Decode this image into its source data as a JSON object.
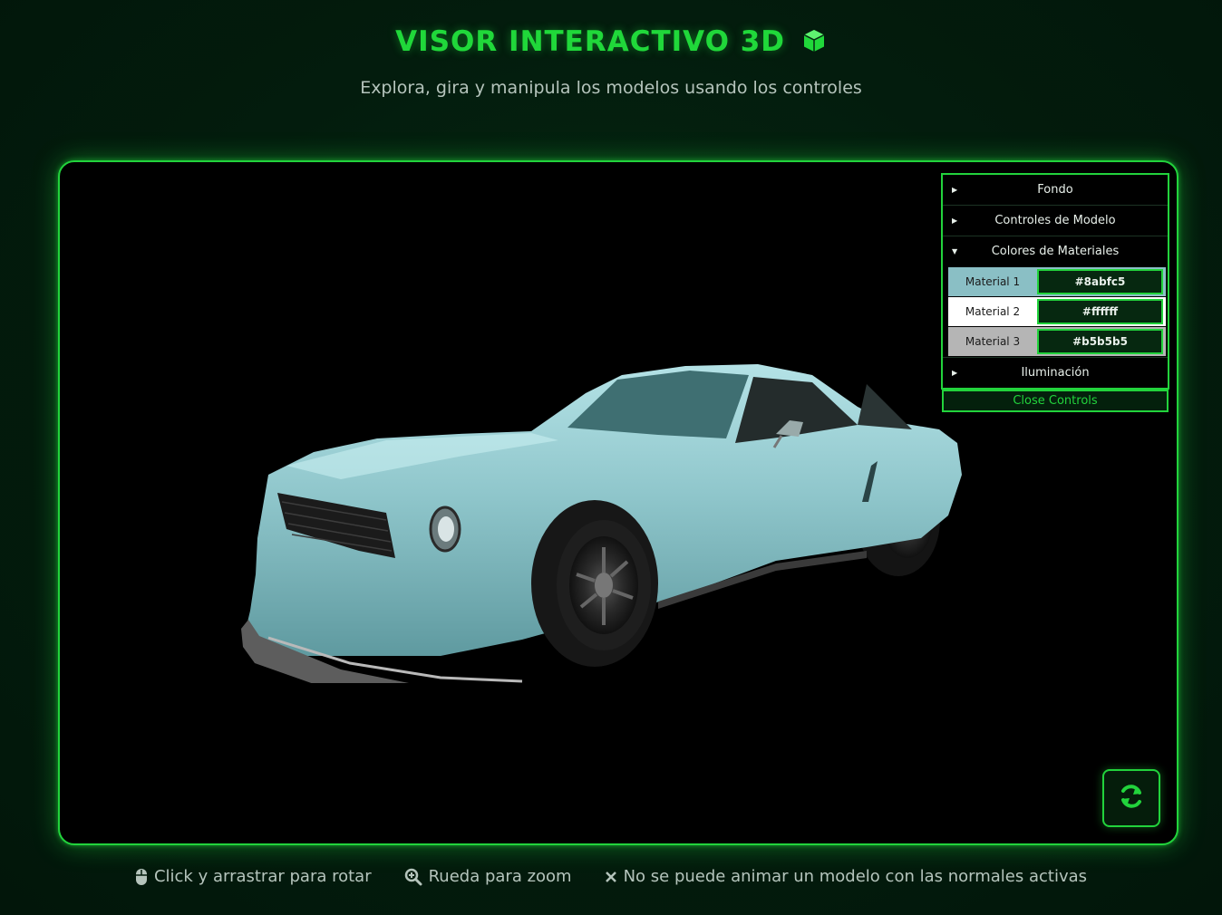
{
  "header": {
    "title": "VISOR INTERACTIVO 3D",
    "title_icon": "cube-icon",
    "subtitle": "Explora, gira y manipula los modelos usando los controles"
  },
  "controls": {
    "folders": [
      {
        "label": "Fondo",
        "expanded": false
      },
      {
        "label": "Controles de Modelo",
        "expanded": false
      },
      {
        "label": "Colores de Materiales",
        "expanded": true
      },
      {
        "label": "Iluminación",
        "expanded": false
      }
    ],
    "materials": [
      {
        "label": "Material 1",
        "value": "#8abfc5"
      },
      {
        "label": "Material 2",
        "value": "#ffffff"
      },
      {
        "label": "Material 3",
        "value": "#b5b5b5"
      }
    ],
    "close_label": "Close Controls"
  },
  "refresh_icon": "refresh-icon",
  "footer": {
    "rotate": {
      "icon": "mouse-icon",
      "text": "Click y arrastrar para rotar"
    },
    "zoom": {
      "icon": "zoom-icon",
      "text": "Rueda para zoom"
    },
    "normals": {
      "icon": "close-icon",
      "text": "No se puede animar un modelo con las normales activas"
    }
  },
  "colors": {
    "accent": "#22d33c",
    "background": "#031c0d",
    "car_body": "#8abfc5"
  }
}
